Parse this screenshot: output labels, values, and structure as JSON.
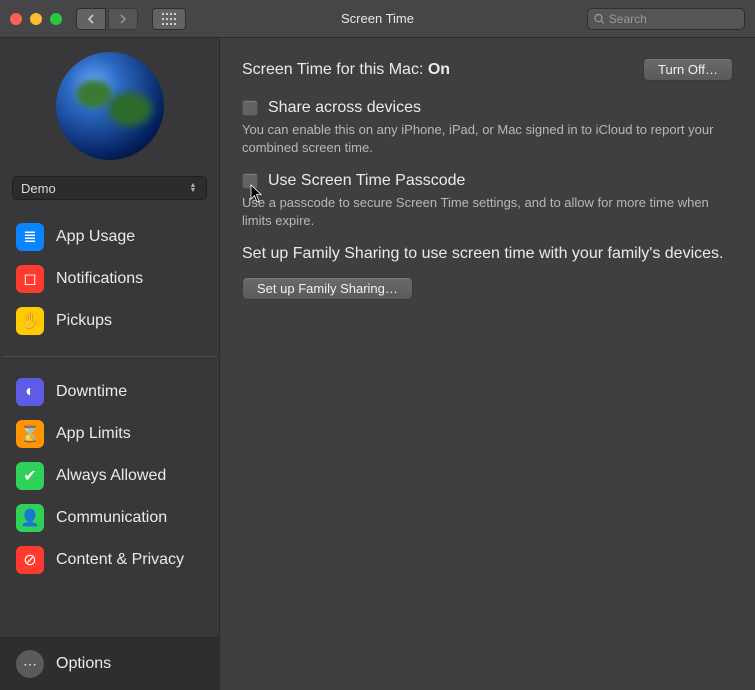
{
  "window": {
    "title": "Screen Time",
    "search_placeholder": "Search"
  },
  "sidebar": {
    "account_name": "Demo",
    "items": [
      {
        "label": "App Usage",
        "iconClass": "ic-blue",
        "glyph": "≣"
      },
      {
        "label": "Notifications",
        "iconClass": "ic-red",
        "glyph": "◻"
      },
      {
        "label": "Pickups",
        "iconClass": "ic-yellow",
        "glyph": "✋"
      }
    ],
    "items2": [
      {
        "label": "Downtime",
        "iconClass": "ic-purple",
        "glyph": "◐"
      },
      {
        "label": "App Limits",
        "iconClass": "ic-orange",
        "glyph": "⌛"
      },
      {
        "label": "Always Allowed",
        "iconClass": "ic-green",
        "glyph": "✔"
      },
      {
        "label": "Communication",
        "iconClass": "ic-green",
        "glyph": "👤"
      },
      {
        "label": "Content & Privacy",
        "iconClass": "ic-red2",
        "glyph": "⊘"
      }
    ],
    "footer_label": "Options"
  },
  "main": {
    "status_prefix": "Screen Time for this Mac: ",
    "status_value": "On",
    "turn_off_label": "Turn Off…",
    "share_label": "Share across devices",
    "share_desc": "You can enable this on any iPhone, iPad, or Mac signed in to iCloud to report your combined screen time.",
    "passcode_label": "Use Screen Time Passcode",
    "passcode_desc": "Use a passcode to secure Screen Time settings, and to allow for more time when limits expire.",
    "family_text": "Set up Family Sharing to use screen time with your family's devices.",
    "family_button": "Set up Family Sharing…"
  }
}
